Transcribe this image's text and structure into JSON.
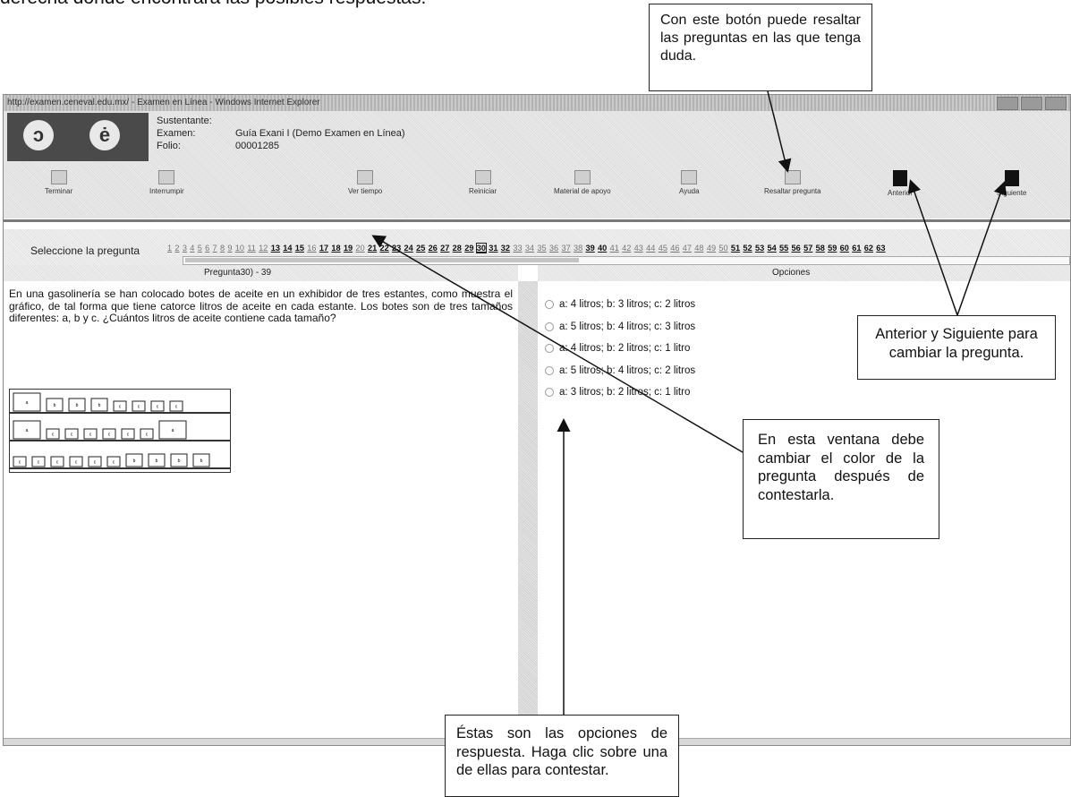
{
  "intro_text": "derecha donde encontrará las posibles respuestas.",
  "window": {
    "title": "http://examen.ceneval.edu.mx/ - Examen en Línea - Windows Internet Explorer"
  },
  "meta": {
    "sustentante_label": "Sustentante:",
    "sustentante_value": "",
    "examen_label": "Examen:",
    "examen_value": "Guía Exani I (Demo Examen en Línea)",
    "folio_label": "Folio:",
    "folio_value": "00001285"
  },
  "toolbar": [
    {
      "label": "Terminar",
      "icon": "finish-icon"
    },
    {
      "label": "Interrumpir",
      "icon": "interrupt-icon"
    },
    {
      "label": "Ver tiempo",
      "icon": "clock-icon"
    },
    {
      "label": "Reiniciar",
      "icon": "restart-icon"
    },
    {
      "label": "Material de apoyo",
      "icon": "support-material-icon"
    },
    {
      "label": "Ayuda",
      "icon": "help-icon"
    },
    {
      "label": "Resaltar pregunta",
      "icon": "highlight-icon"
    },
    {
      "label": "Anterior",
      "icon": "previous-icon"
    },
    {
      "label": "Siguiente",
      "icon": "next-icon"
    }
  ],
  "question_selector": {
    "label": "Seleccione la pregunta",
    "numbers": [
      "1",
      "2",
      "3",
      "4",
      "5",
      "6",
      "7",
      "8",
      "9",
      "10",
      "11",
      "12",
      "13",
      "14",
      "15",
      "16",
      "17",
      "18",
      "19",
      "20",
      "21",
      "22",
      "23",
      "24",
      "25",
      "26",
      "27",
      "28",
      "29",
      "30",
      "31",
      "32",
      "33",
      "34",
      "35",
      "36",
      "37",
      "38",
      "39",
      "40",
      "41",
      "42",
      "43",
      "44",
      "45",
      "46",
      "47",
      "48",
      "49",
      "50",
      "51",
      "52",
      "53",
      "54",
      "55",
      "56",
      "57",
      "58",
      "59",
      "60",
      "61",
      "62",
      "63"
    ],
    "answered": [
      "13",
      "14",
      "15",
      "17",
      "18",
      "19",
      "21",
      "22",
      "23",
      "24",
      "25",
      "26",
      "27",
      "28",
      "29",
      "30",
      "31",
      "32",
      "39",
      "40",
      "51",
      "52",
      "53",
      "54",
      "55",
      "56",
      "57",
      "58",
      "59",
      "60",
      "61",
      "62",
      "63"
    ],
    "current": "30"
  },
  "question": {
    "header": "Pregunta30) - 39",
    "text": "En una gasolinería se han colocado botes de aceite en un exhibidor de tres estantes, como muestra el gráfico, de tal forma que tiene catorce litros de aceite en cada estante. Los botes son de tres tamaños diferentes: a, b y c. ¿Cuántos litros de aceite contiene cada tamaño?",
    "shelves": [
      [
        "a",
        "b",
        "b",
        "b",
        "c",
        "c",
        "c",
        "c"
      ],
      [
        "a",
        "c",
        "c",
        "c",
        "c",
        "c",
        "c",
        "a"
      ],
      [
        "c",
        "c",
        "c",
        "c",
        "c",
        "c",
        "b",
        "b",
        "b",
        "b"
      ]
    ]
  },
  "options": {
    "header": "Opciones",
    "items": [
      "a: 4 litros; b: 3 litros; c: 2 litros",
      "a: 5 litros; b: 4 litros; c: 3 litros",
      "a: 4 litros; b: 2 litros; c: 1 litro",
      "a: 5 litros; b: 4 litros; c: 2 litros",
      "a: 3 litros; b: 2 litros; c: 1 litro"
    ]
  },
  "callouts": {
    "resaltar": "Con este botón puede resaltar las preguntas en las que tenga duda.",
    "navegacion": "Anterior y Siguiente para cambiar la pregunta.",
    "ventana": "En esta ventana debe cambiar el color de la pregunta después de contestarla.",
    "opciones": "Éstas son las opciones de respuesta. Haga clic sobre una de ellas para contestar."
  }
}
